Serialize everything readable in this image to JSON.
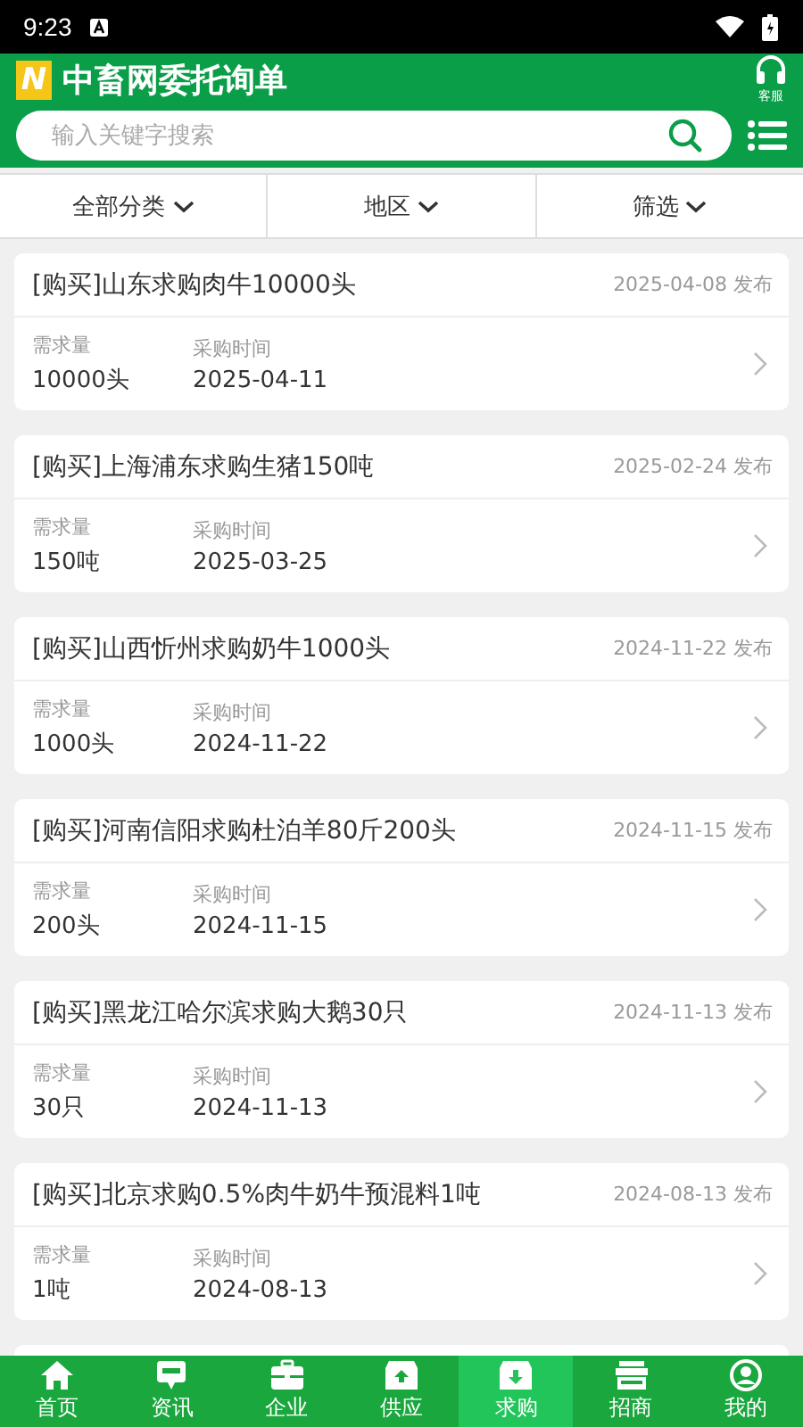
{
  "status_bar": {
    "time": "9:23"
  },
  "header": {
    "logo": "N",
    "title": "中畜网委托询单",
    "service_label": "客服"
  },
  "search": {
    "placeholder": "输入关键字搜索"
  },
  "filters": [
    {
      "label": "全部分类"
    },
    {
      "label": "地区"
    },
    {
      "label": "筛选"
    }
  ],
  "listings": [
    {
      "title": "[购买]山东求购肉牛10000头",
      "published": "2025-04-08 发布",
      "quantity_label": "需求量",
      "quantity": "10000头",
      "date_label": "采购时间",
      "date": "2025-04-11"
    },
    {
      "title": "[购买]上海浦东求购生猪150吨",
      "published": "2025-02-24 发布",
      "quantity_label": "需求量",
      "quantity": "150吨",
      "date_label": "采购时间",
      "date": "2025-03-25"
    },
    {
      "title": "[购买]山西忻州求购奶牛1000头",
      "published": "2024-11-22 发布",
      "quantity_label": "需求量",
      "quantity": "1000头",
      "date_label": "采购时间",
      "date": "2024-11-22"
    },
    {
      "title": "[购买]河南信阳求购杜泊羊80斤200头",
      "published": "2024-11-15 发布",
      "quantity_label": "需求量",
      "quantity": "200头",
      "date_label": "采购时间",
      "date": "2024-11-15"
    },
    {
      "title": "[购买]黑龙江哈尔滨求购大鹅30只",
      "published": "2024-11-13 发布",
      "quantity_label": "需求量",
      "quantity": "30只",
      "date_label": "采购时间",
      "date": "2024-11-13"
    },
    {
      "title": "[购买]北京求购0.5%肉牛奶牛预混料1吨",
      "published": "2024-08-13 发布",
      "quantity_label": "需求量",
      "quantity": "1吨",
      "date_label": "采购时间",
      "date": "2024-08-13"
    }
  ],
  "tabs": [
    {
      "kind": "home",
      "label": "首页",
      "selected": false
    },
    {
      "kind": "news",
      "label": "资讯",
      "selected": false
    },
    {
      "kind": "company",
      "label": "企业",
      "selected": false
    },
    {
      "kind": "supply",
      "label": "供应",
      "selected": false
    },
    {
      "kind": "purchase",
      "label": "求购",
      "selected": true
    },
    {
      "kind": "shop",
      "label": "招商",
      "selected": false
    },
    {
      "kind": "me",
      "label": "我的",
      "selected": false
    }
  ]
}
